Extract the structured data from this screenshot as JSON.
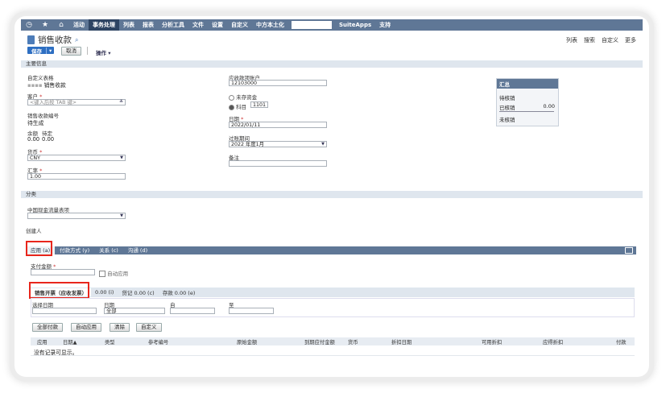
{
  "nav": {
    "icons": [
      "clock-icon",
      "star-icon",
      "home-icon"
    ],
    "items": [
      {
        "label": "活动",
        "active": false
      },
      {
        "label": "事务处理",
        "active": true
      },
      {
        "label": "列表",
        "active": false
      },
      {
        "label": "报表",
        "active": false
      },
      {
        "label": "分析工具",
        "active": false
      },
      {
        "label": "文件",
        "active": false
      },
      {
        "label": "设置",
        "active": false
      },
      {
        "label": "自定义",
        "active": false
      },
      {
        "label": "中方本土化",
        "active": false
      }
    ],
    "items2": [
      {
        "label": "SuiteApps"
      },
      {
        "label": "支持"
      }
    ]
  },
  "page": {
    "title": "销售收款"
  },
  "topright": {
    "list": "列表",
    "search": "搜索",
    "customize": "自定义",
    "more": "更多"
  },
  "toolbar": {
    "save": "保存",
    "cancel": "取消",
    "actions": "操作 ▾"
  },
  "main": {
    "section": "主要信息",
    "custom_form_label": "自定义表格",
    "custom_form_value": "销售收款",
    "customer_label": "客户",
    "customer_placeholder": "<键入后按 TAB 键>",
    "number_label": "销售收款编号",
    "number_value": "待生成",
    "balance_label": "余额",
    "pending_label": "待定",
    "balance_value": "0.00",
    "pending_value": "0.00",
    "currency_label": "货币",
    "currency_value": "CNY",
    "rate_label": "汇率",
    "rate_value": "1.00",
    "ar_label": "应收款项账户",
    "ar_value": "12103000",
    "undep_label": "未存资金",
    "account_label": "科目",
    "account_value": "1101",
    "date_label": "日期",
    "date_value": "2022/01/11",
    "period_label": "过账期间",
    "period_value": "2022 年度1月",
    "memo_label": "备注"
  },
  "summary": {
    "title": "汇总",
    "applied_label": "待核销",
    "applied2_label": "已核销",
    "applied2_value": "0.00",
    "unapplied_label": "未核销"
  },
  "classification": {
    "section": "分类",
    "cashflow_label": "中国现金流量表项",
    "created_by_label": "创建人"
  },
  "tabs": [
    {
      "label": "应用 (a)",
      "active": true
    },
    {
      "label": "付款方式 (y)",
      "active": false
    },
    {
      "label": "关系 (c)",
      "active": false
    },
    {
      "label": "沟通 (d)",
      "active": false
    }
  ],
  "payment": {
    "amount_label": "支付金额",
    "auto_apply_label": "自动应用"
  },
  "subtabs": [
    {
      "label": "销售开票（应收发票）",
      "active": true
    },
    {
      "label": "0.00 (i)",
      "active": false
    },
    {
      "label": "贷记 0.00 (c)",
      "active": false
    },
    {
      "label": "存款 0.00 (e)",
      "active": false
    }
  ],
  "filter": {
    "select_label": "选择日期",
    "date_label": "日期",
    "date_value": "全部",
    "from_label": "自",
    "to_label": "至"
  },
  "buttons": {
    "pay_all": "全部付款",
    "auto_apply": "自动应用",
    "clear": "清除",
    "customize": "自定义"
  },
  "grid": {
    "columns": [
      "应用",
      "日期▲",
      "类型",
      "参考编号",
      "原始金额",
      "到期应付金额",
      "货币",
      "折扣日期",
      "可用折扣",
      "应得折扣",
      "付款"
    ],
    "empty": "没有记录可显示。"
  }
}
